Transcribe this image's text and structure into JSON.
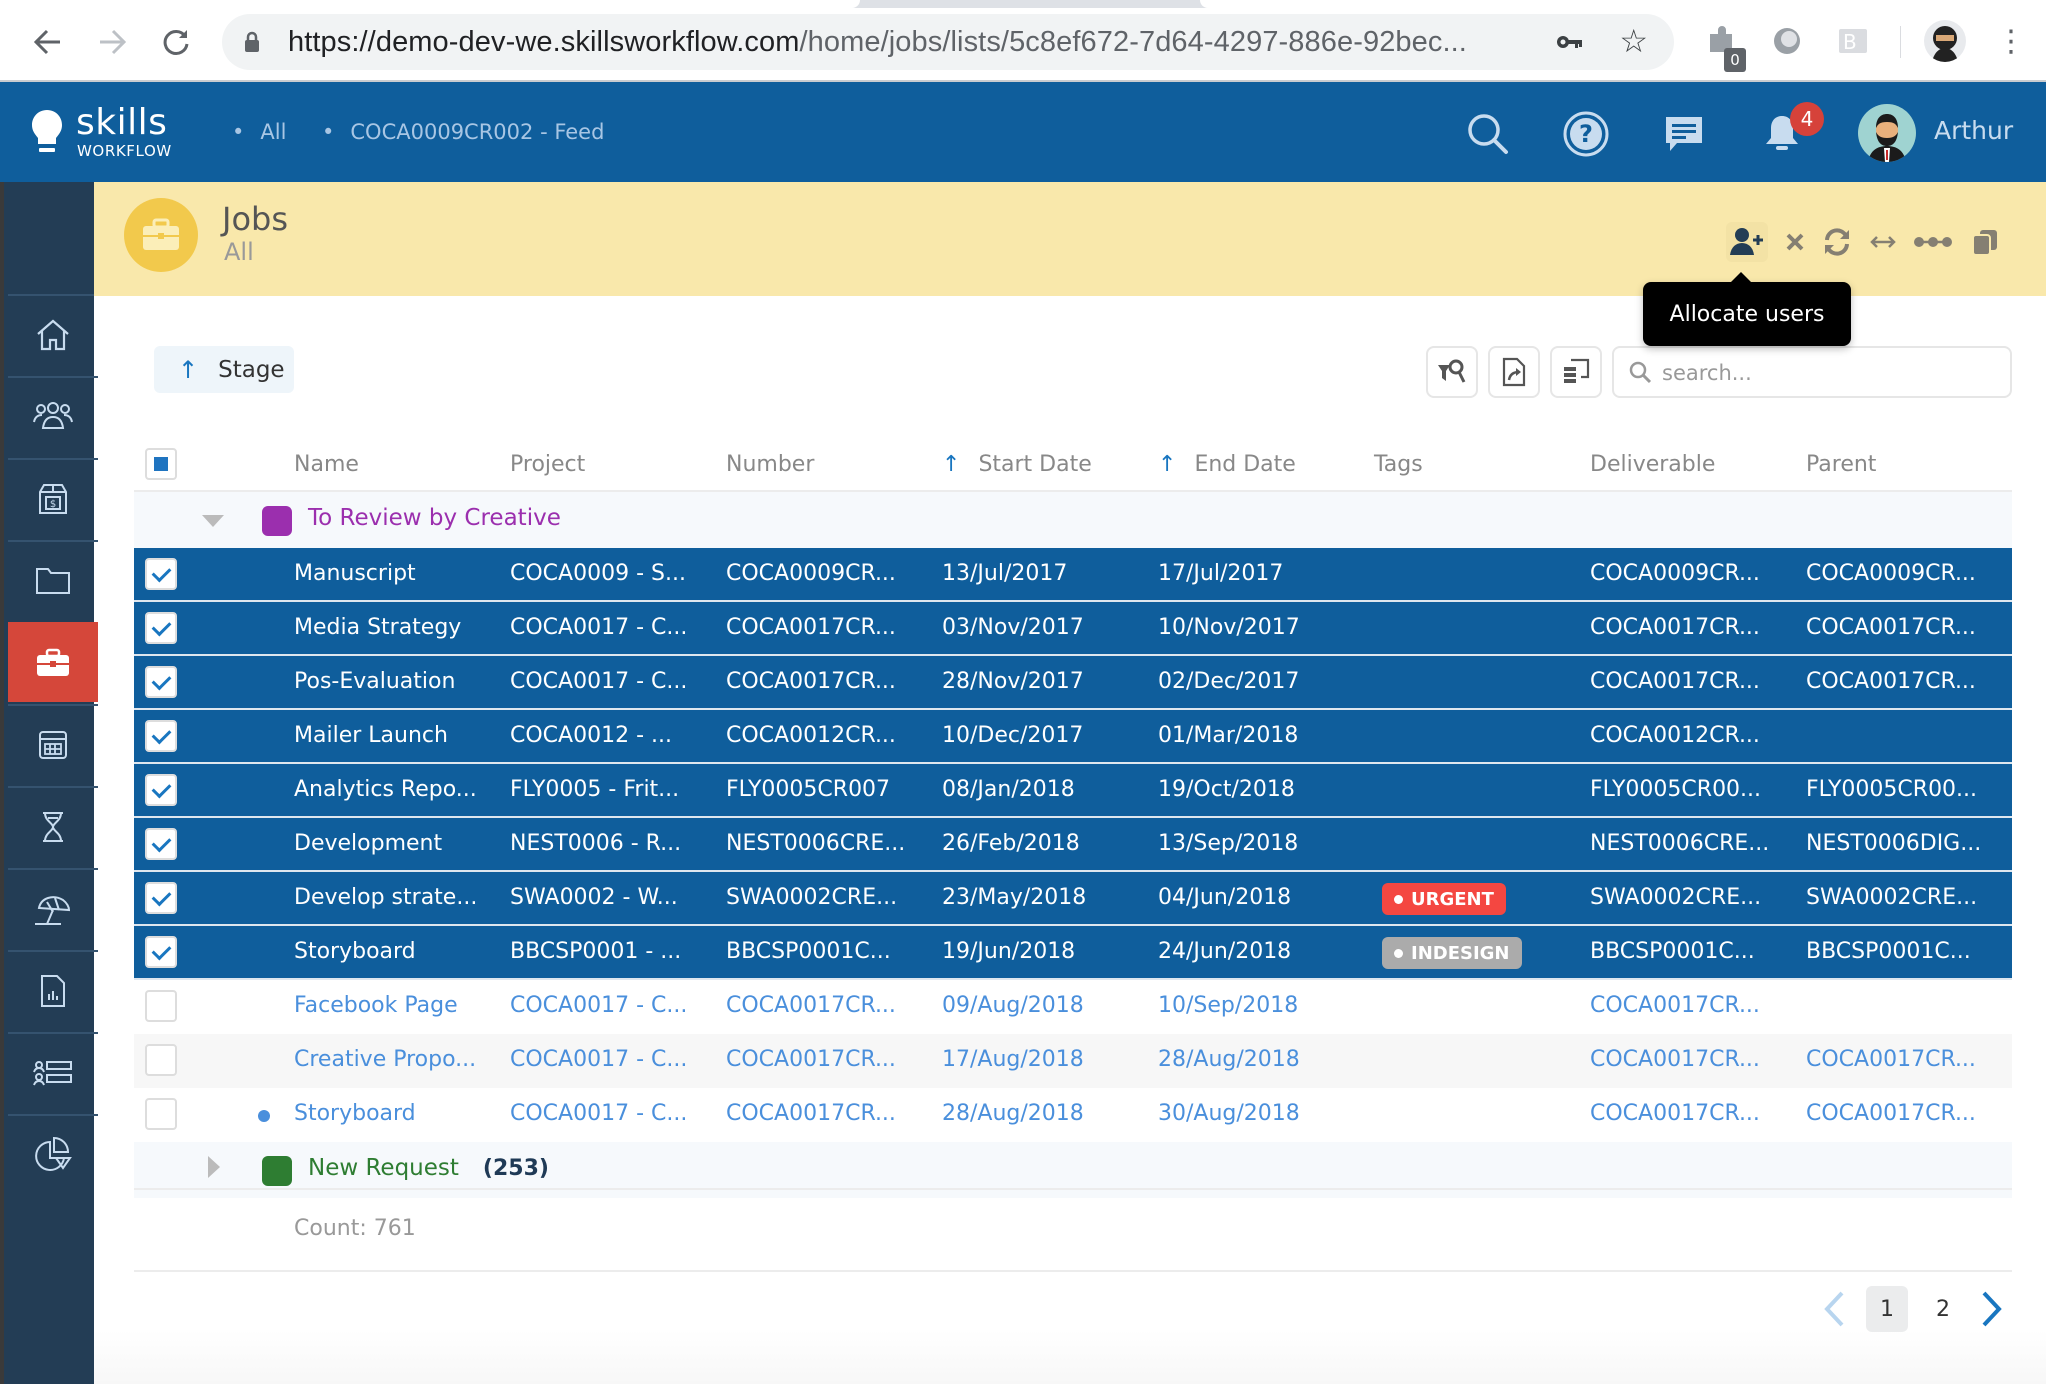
{
  "browser": {
    "url_host": "https://demo-dev-we.skillsworkflow.com",
    "url_path": "/home/jobs/lists/5c8ef672-7d64-4297-886e-92bec...",
    "extension_badge": "0"
  },
  "header": {
    "logo_main": "skills",
    "logo_sub": "WORKFLOW",
    "breadcrumbs": [
      "All",
      "COCA0009CR002 - Feed"
    ],
    "notification_count": "4",
    "user_name": "Arthur"
  },
  "sidebar": {
    "items": [
      {
        "icon": "home-icon",
        "label": "Home"
      },
      {
        "icon": "people-icon",
        "label": "Contacts"
      },
      {
        "icon": "budget-box-icon",
        "label": "Budget"
      },
      {
        "icon": "folder-icon",
        "label": "Projects"
      },
      {
        "icon": "briefcase-icon",
        "label": "Jobs",
        "active": true
      },
      {
        "icon": "calendar-icon",
        "label": "Calendar"
      },
      {
        "icon": "hourglass-icon",
        "label": "Timesheets"
      },
      {
        "icon": "beach-umbrella-icon",
        "label": "Absences"
      },
      {
        "icon": "report-icon",
        "label": "Reports"
      },
      {
        "icon": "resources-icon",
        "label": "Resources"
      },
      {
        "icon": "pie-chart-icon",
        "label": "Analytics"
      }
    ]
  },
  "banner": {
    "title": "Jobs",
    "subtitle": "All",
    "actions": [
      "allocate-users",
      "close",
      "refresh",
      "expand",
      "more",
      "copy"
    ],
    "tooltip": "Allocate users"
  },
  "toolbar": {
    "stage_sort_label": "Stage",
    "search_placeholder": "search..."
  },
  "table": {
    "columns": [
      {
        "key": "name",
        "label": "Name"
      },
      {
        "key": "project",
        "label": "Project"
      },
      {
        "key": "number",
        "label": "Number"
      },
      {
        "key": "start",
        "label": "Start Date",
        "sorted": "asc"
      },
      {
        "key": "end",
        "label": "End Date",
        "sorted": "asc"
      },
      {
        "key": "tags",
        "label": "Tags"
      },
      {
        "key": "deliverable",
        "label": "Deliverable"
      },
      {
        "key": "parent",
        "label": "Parent"
      }
    ],
    "groups": [
      {
        "label": "To Review by Creative",
        "color": "#9b2fae",
        "expanded": true,
        "count": "",
        "rows": [
          {
            "selected": true,
            "name": "Manuscript",
            "project": "COCA0009 - S...",
            "number": "COCA0009CR...",
            "start": "13/Jul/2017",
            "end": "17/Jul/2017",
            "tag": null,
            "deliverable": "COCA0009CR...",
            "parent": "COCA0009CR..."
          },
          {
            "selected": true,
            "name": "Media Strategy",
            "project": "COCA0017 - C...",
            "number": "COCA0017CR...",
            "start": "03/Nov/2017",
            "end": "10/Nov/2017",
            "tag": null,
            "deliverable": "COCA0017CR...",
            "parent": "COCA0017CR..."
          },
          {
            "selected": true,
            "name": "Pos-Evaluation",
            "project": "COCA0017 - C...",
            "number": "COCA0017CR...",
            "start": "28/Nov/2017",
            "end": "02/Dec/2017",
            "tag": null,
            "deliverable": "COCA0017CR...",
            "parent": "COCA0017CR..."
          },
          {
            "selected": true,
            "name": "Mailer Launch",
            "project": "COCA0012 - ...",
            "number": "COCA0012CR...",
            "start": "10/Dec/2017",
            "end": "01/Mar/2018",
            "tag": null,
            "deliverable": "COCA0012CR...",
            "parent": ""
          },
          {
            "selected": true,
            "name": "Analytics Repo...",
            "project": "FLY0005 - Frit...",
            "number": "FLY0005CR007",
            "start": "08/Jan/2018",
            "end": "19/Oct/2018",
            "tag": null,
            "deliverable": "FLY0005CR00...",
            "parent": "FLY0005CR00..."
          },
          {
            "selected": true,
            "name": "Development",
            "project": "NEST0006 - R...",
            "number": "NEST0006CRE...",
            "start": "26/Feb/2018",
            "end": "13/Sep/2018",
            "tag": null,
            "deliverable": "NEST0006CRE...",
            "parent": "NEST0006DIG..."
          },
          {
            "selected": true,
            "name": "Develop strate...",
            "project": "SWA0002 - W...",
            "number": "SWA0002CRE...",
            "start": "23/May/2018",
            "end": "04/Jun/2018",
            "tag": {
              "label": "URGENT",
              "color": "#f44741"
            },
            "deliverable": "SWA0002CRE...",
            "parent": "SWA0002CRE..."
          },
          {
            "selected": true,
            "name": "Storyboard",
            "project": "BBCSP0001 - ...",
            "number": "BBCSP0001C...",
            "start": "19/Jun/2018",
            "end": "24/Jun/2018",
            "tag": {
              "label": "INDESIGN",
              "color": "#ababab"
            },
            "deliverable": "BBCSP0001C...",
            "parent": "BBCSP0001C..."
          },
          {
            "selected": false,
            "name": "Facebook Page",
            "project": "COCA0017 - C...",
            "number": "COCA0017CR...",
            "start": "09/Aug/2018",
            "end": "10/Sep/2018",
            "tag": null,
            "deliverable": "COCA0017CR...",
            "parent": ""
          },
          {
            "selected": false,
            "name": "Creative Propo...",
            "project": "COCA0017 - C...",
            "number": "COCA0017CR...",
            "start": "17/Aug/2018",
            "end": "28/Aug/2018",
            "tag": null,
            "deliverable": "COCA0017CR...",
            "parent": "COCA0017CR..."
          },
          {
            "selected": false,
            "unread": true,
            "name": "Storyboard",
            "project": "COCA0017 - C...",
            "number": "COCA0017CR...",
            "start": "28/Aug/2018",
            "end": "30/Aug/2018",
            "tag": null,
            "deliverable": "COCA0017CR...",
            "parent": "COCA0017CR..."
          }
        ]
      },
      {
        "label": "New Request",
        "color": "#2e7d32",
        "expanded": false,
        "count": "(253)",
        "rows": []
      }
    ],
    "count_label": "Count: 761"
  },
  "pagination": {
    "pages": [
      "1",
      "2"
    ],
    "current": "1"
  },
  "colors": {
    "primary": "#0f5e9c",
    "sidebar": "#233d55",
    "active_nav": "#d5473a",
    "banner": "#f9e8ab",
    "link": "#4a8fdc"
  }
}
